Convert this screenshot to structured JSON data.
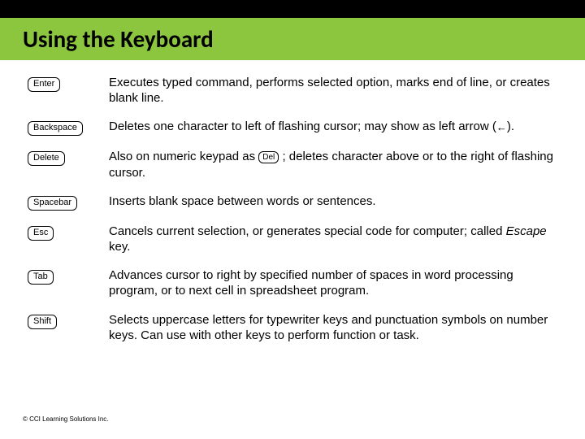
{
  "title": "Using the Keyboard",
  "rows": [
    {
      "key": "Enter",
      "desc": "Executes typed command, performs selected option, marks end of line, or creates blank line."
    },
    {
      "key": "Backspace",
      "desc_pre": "Deletes one character to left of flashing cursor; may show as left arrow (",
      "arrow": "←",
      "desc_post": ")."
    },
    {
      "key": "Delete",
      "desc_pre": "Also on numeric keypad as ",
      "inline_key": "Del",
      "desc_post": " ; deletes character above or to the right of flashing cursor."
    },
    {
      "key": "Spacebar",
      "desc": "Inserts blank space between words or sentences."
    },
    {
      "key": "Esc",
      "desc_pre": "Cancels current selection, or generates special code for computer; called ",
      "italic": "Escape",
      "desc_post": " key."
    },
    {
      "key": "Tab",
      "desc": "Advances cursor to right by specified number of spaces in word processing program, or to next cell in spreadsheet program."
    },
    {
      "key": "Shift",
      "desc": "Selects uppercase letters for typewriter keys and punctuation symbols on number keys. Can use with other keys to perform function or task."
    }
  ],
  "footer": "© CCI Learning Solutions Inc."
}
